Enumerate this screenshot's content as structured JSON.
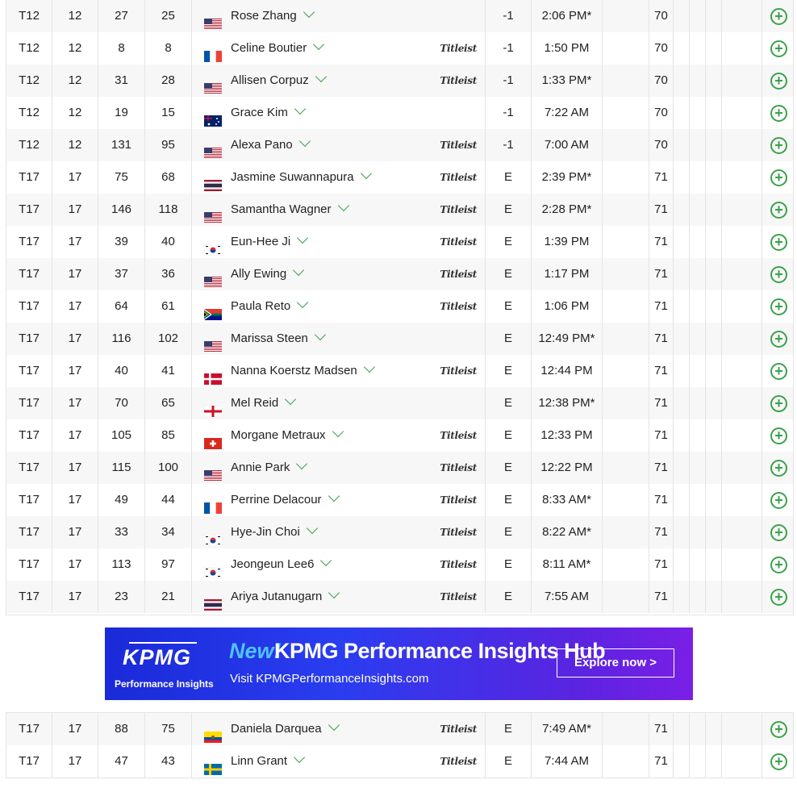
{
  "rows_top": [
    {
      "pos": "T12",
      "prev": "12",
      "rank1": "27",
      "rank2": "25",
      "country": "us",
      "name": "Rose Zhang",
      "titleist": false,
      "topar": "-1",
      "tee": "2:06 PM*",
      "r1": "70"
    },
    {
      "pos": "T12",
      "prev": "12",
      "rank1": "8",
      "rank2": "8",
      "country": "fr",
      "name": "Celine Boutier",
      "titleist": true,
      "topar": "-1",
      "tee": "1:50 PM",
      "r1": "70"
    },
    {
      "pos": "T12",
      "prev": "12",
      "rank1": "31",
      "rank2": "28",
      "country": "us",
      "name": "Allisen Corpuz",
      "titleist": true,
      "topar": "-1",
      "tee": "1:33 PM*",
      "r1": "70"
    },
    {
      "pos": "T12",
      "prev": "12",
      "rank1": "19",
      "rank2": "15",
      "country": "au",
      "name": "Grace Kim",
      "titleist": false,
      "topar": "-1",
      "tee": "7:22 AM",
      "r1": "70"
    },
    {
      "pos": "T12",
      "prev": "12",
      "rank1": "131",
      "rank2": "95",
      "country": "us",
      "name": "Alexa Pano",
      "titleist": true,
      "topar": "-1",
      "tee": "7:00 AM",
      "r1": "70"
    },
    {
      "pos": "T17",
      "prev": "17",
      "rank1": "75",
      "rank2": "68",
      "country": "th",
      "name": "Jasmine Suwannapura",
      "titleist": true,
      "topar": "E",
      "tee": "2:39 PM*",
      "r1": "71"
    },
    {
      "pos": "T17",
      "prev": "17",
      "rank1": "146",
      "rank2": "118",
      "country": "us",
      "name": "Samantha Wagner",
      "titleist": true,
      "topar": "E",
      "tee": "2:28 PM*",
      "r1": "71"
    },
    {
      "pos": "T17",
      "prev": "17",
      "rank1": "39",
      "rank2": "40",
      "country": "kr",
      "name": "Eun-Hee Ji",
      "titleist": true,
      "topar": "E",
      "tee": "1:39 PM",
      "r1": "71"
    },
    {
      "pos": "T17",
      "prev": "17",
      "rank1": "37",
      "rank2": "36",
      "country": "us",
      "name": "Ally Ewing",
      "titleist": true,
      "topar": "E",
      "tee": "1:17 PM",
      "r1": "71"
    },
    {
      "pos": "T17",
      "prev": "17",
      "rank1": "64",
      "rank2": "61",
      "country": "za",
      "name": "Paula Reto",
      "titleist": true,
      "topar": "E",
      "tee": "1:06 PM",
      "r1": "71"
    },
    {
      "pos": "T17",
      "prev": "17",
      "rank1": "116",
      "rank2": "102",
      "country": "us",
      "name": "Marissa Steen",
      "titleist": false,
      "topar": "E",
      "tee": "12:49 PM*",
      "r1": "71"
    },
    {
      "pos": "T17",
      "prev": "17",
      "rank1": "40",
      "rank2": "41",
      "country": "dk",
      "name": "Nanna Koerstz Madsen",
      "titleist": true,
      "topar": "E",
      "tee": "12:44 PM",
      "r1": "71"
    },
    {
      "pos": "T17",
      "prev": "17",
      "rank1": "70",
      "rank2": "65",
      "country": "en",
      "name": "Mel Reid",
      "titleist": false,
      "topar": "E",
      "tee": "12:38 PM*",
      "r1": "71"
    },
    {
      "pos": "T17",
      "prev": "17",
      "rank1": "105",
      "rank2": "85",
      "country": "ch",
      "name": "Morgane Metraux",
      "titleist": true,
      "topar": "E",
      "tee": "12:33 PM",
      "r1": "71"
    },
    {
      "pos": "T17",
      "prev": "17",
      "rank1": "115",
      "rank2": "100",
      "country": "us",
      "name": "Annie Park",
      "titleist": true,
      "topar": "E",
      "tee": "12:22 PM",
      "r1": "71"
    },
    {
      "pos": "T17",
      "prev": "17",
      "rank1": "49",
      "rank2": "44",
      "country": "fr",
      "name": "Perrine Delacour",
      "titleist": true,
      "topar": "E",
      "tee": "8:33 AM*",
      "r1": "71"
    },
    {
      "pos": "T17",
      "prev": "17",
      "rank1": "33",
      "rank2": "34",
      "country": "kr",
      "name": "Hye-Jin Choi",
      "titleist": true,
      "topar": "E",
      "tee": "8:22 AM*",
      "r1": "71"
    },
    {
      "pos": "T17",
      "prev": "17",
      "rank1": "113",
      "rank2": "97",
      "country": "kr",
      "name": "Jeongeun Lee6",
      "titleist": true,
      "topar": "E",
      "tee": "8:11 AM*",
      "r1": "71"
    },
    {
      "pos": "T17",
      "prev": "17",
      "rank1": "23",
      "rank2": "21",
      "country": "th",
      "name": "Ariya Jutanugarn",
      "titleist": true,
      "topar": "E",
      "tee": "7:55 AM",
      "r1": "71"
    }
  ],
  "rows_bottom": [
    {
      "pos": "T17",
      "prev": "17",
      "rank1": "88",
      "rank2": "75",
      "country": "ec",
      "name": "Daniela Darquea",
      "titleist": true,
      "topar": "E",
      "tee": "7:49 AM*",
      "r1": "71"
    },
    {
      "pos": "T17",
      "prev": "17",
      "rank1": "47",
      "rank2": "43",
      "country": "se",
      "name": "Linn Grant",
      "titleist": true,
      "topar": "E",
      "tee": "7:44 AM",
      "r1": "71"
    }
  ],
  "sponsor_label": "Titleist",
  "banner": {
    "logo": "KPMG",
    "logo_sub": "Performance Insights",
    "new": "New!",
    "title": "KPMG Performance Insights Hub",
    "url": "Visit KPMGPerformanceInsights.com",
    "cta": "Explore now >"
  },
  "colors": {
    "accent": "#3aa14a",
    "banner_start": "#1a2ad8",
    "banner_end": "#7a1fe6",
    "new_text": "#4fc3f7"
  }
}
